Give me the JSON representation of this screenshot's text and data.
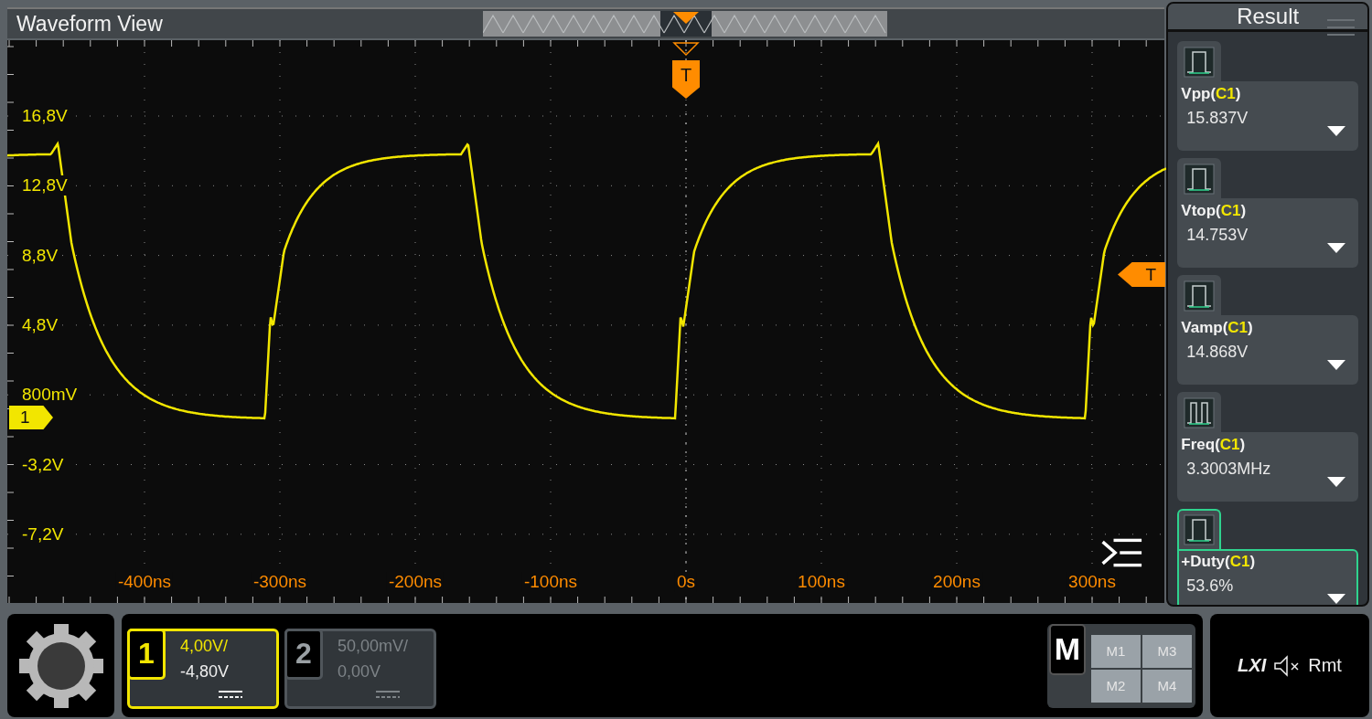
{
  "waveform_view": {
    "title": "Waveform View",
    "y_labels": [
      "16,8V",
      "12,8V",
      "8,8V",
      "4,8V",
      "800mV",
      "-3,2V",
      "-7,2V"
    ],
    "x_labels": [
      "-400ns",
      "-300ns",
      "-200ns",
      "-100ns",
      "0s",
      "100ns",
      "200ns",
      "300ns"
    ],
    "trigger_time_marker": "T",
    "trigger_level_marker": "T",
    "channel_marker": "1"
  },
  "result_panel": {
    "title": "Result",
    "measurements": [
      {
        "label": "Vpp(",
        "source": "C1",
        "label_end": ")",
        "value": "15.837V",
        "selected": false
      },
      {
        "label": "Vtop(",
        "source": "C1",
        "label_end": ")",
        "value": "14.753V",
        "selected": false
      },
      {
        "label": "Vamp(",
        "source": "C1",
        "label_end": ")",
        "value": "14.868V",
        "selected": false
      },
      {
        "label": "Freq(",
        "source": "C1",
        "label_end": ")",
        "value": "3.3003MHz",
        "selected": false
      },
      {
        "label": "+Duty(",
        "source": "C1",
        "label_end": ")",
        "value": "53.6%",
        "selected": true
      }
    ]
  },
  "channels": [
    {
      "number": "1",
      "scale": "4,00V/",
      "offset": "-4,80V",
      "active": true
    },
    {
      "number": "2",
      "scale": "50,00mV/",
      "offset": "0,00V",
      "active": false
    }
  ],
  "math": {
    "label": "M",
    "slots": [
      "M1",
      "M3",
      "M2",
      "M4"
    ]
  },
  "status": {
    "lxi": "LXI",
    "remote": "Rmt"
  }
}
